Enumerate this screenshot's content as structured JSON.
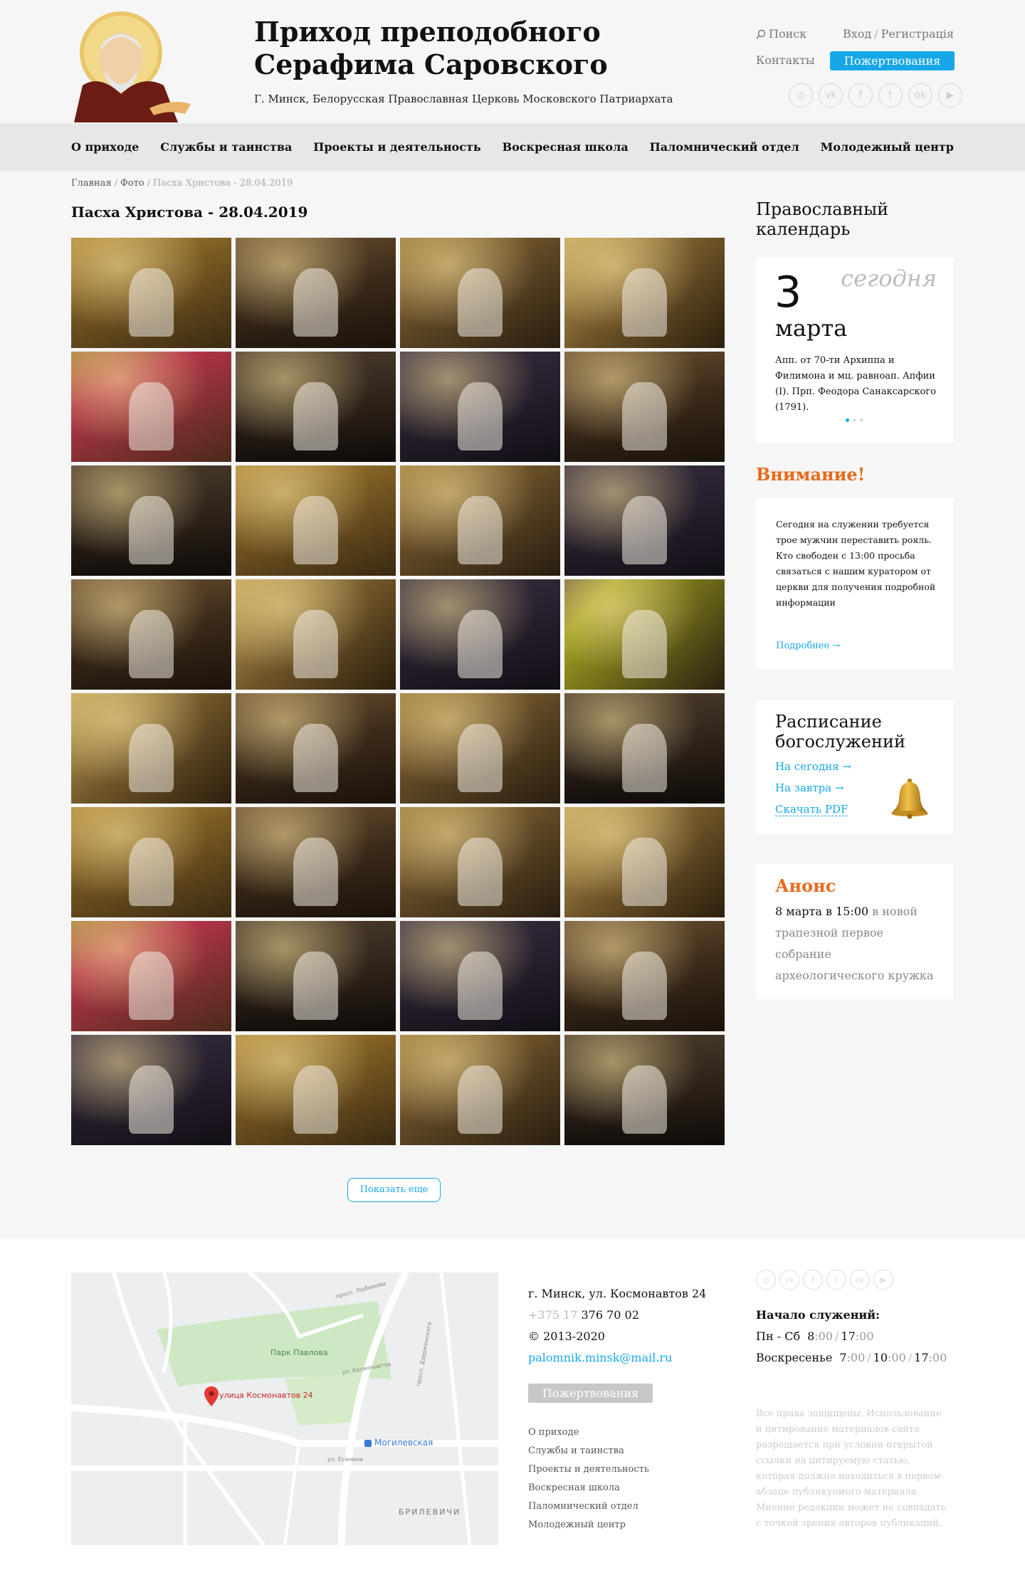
{
  "header": {
    "title_line1": "Приход преподобного",
    "title_line2": "Серафима Саровского",
    "subtitle": "Г. Минск, Белорусская Православная Церковь Московского Патриархата",
    "search_label": "Поиск",
    "login_label": "Вход",
    "register_label": "Регистрація",
    "contacts_label": "Контакты",
    "donate_label": "Пожертвования",
    "socials": [
      "instagram-icon",
      "vk-icon",
      "facebook-icon",
      "twitter-icon",
      "odnoklassniki-icon",
      "youtube-icon"
    ]
  },
  "nav": {
    "items": [
      "О приходе",
      "Службы и таинства",
      "Проекты и деятельность",
      "Воскресная школа",
      "Паломнический отдел",
      "Молодежный центр"
    ]
  },
  "breadcrumb": {
    "home": "Главная",
    "photo": "Фото",
    "current": "Пасха Христова - 28.04.2019"
  },
  "page_title": "Пасха Христова - 28.04.2019",
  "gallery": {
    "photo_count": 32,
    "load_more_label": "Показать еще"
  },
  "sidebar": {
    "calendar_title": "Православный календарь",
    "calendar_day": "3",
    "calendar_today": "сегодня",
    "calendar_month": "марта",
    "calendar_desc": "Апп. от 70-ти Архиппа и Филимона и мц. равноап. Апфии (I). Прп. Феодора Санаксарского (1791).",
    "attention_title": "Внимание!",
    "attention_text": "Сегодня на служении требуется трое мужчин переставить рояль. Кто свободен с 13:00 просьба связаться с нашим куратором от церкви для получения подробной информации",
    "attention_more": "Подробнее →",
    "schedule_title": "Расписание богослужений",
    "schedule_today": "На сегодня  →",
    "schedule_tomorrow": "На завтра  →",
    "schedule_pdf": "Скачать PDF",
    "announce_title": "Анонс",
    "announce_strong": "8 марта в 15:00",
    "announce_rest": " в новой трапезной первое собрание археологического кружка"
  },
  "footer": {
    "map_labels": {
      "park": "Парк Павлова",
      "pin": "улица Космонавтов 24",
      "metro": "Могилевская",
      "district": "БРИЛЕВИЧИ",
      "street1": "просп. Любимова",
      "street2": "ул. Космонавтов",
      "street3": "ул. Есенина",
      "street4": "просп. Дзержинского"
    },
    "address": "г. Минск, ул. Космонавтов 24",
    "phone_code": "+375 17",
    "phone_number": "376 70 02",
    "copyright": "©  2013-2020",
    "email": "palomnik.minsk@mail.ru",
    "donate_label": "Пожертвования",
    "menu": [
      "О приходе",
      "Службы и таинства",
      "Проекты и деятельность",
      "Воскресная школа",
      "Паломнический отдел",
      "Молодежный центр"
    ],
    "hours_title": "Начало служений:",
    "weekdays_label": "Пн - Сб",
    "weekdays_times": [
      [
        "8",
        ":00"
      ],
      [
        "17",
        ":00"
      ]
    ],
    "sunday_label": "Воскресенье",
    "sunday_times": [
      [
        "7",
        ":00"
      ],
      [
        "10",
        ":00"
      ],
      [
        "17",
        ":00"
      ]
    ],
    "rights": "Все права защищены. Использование и цитирование материалов сайта разрешается при условии открытой ссылки на цитируемую статью, которая должна находиться в первом абзаце публикуемого материала. Мнение редакции может не совпадать с точкой зрения авторов публикаций."
  }
}
